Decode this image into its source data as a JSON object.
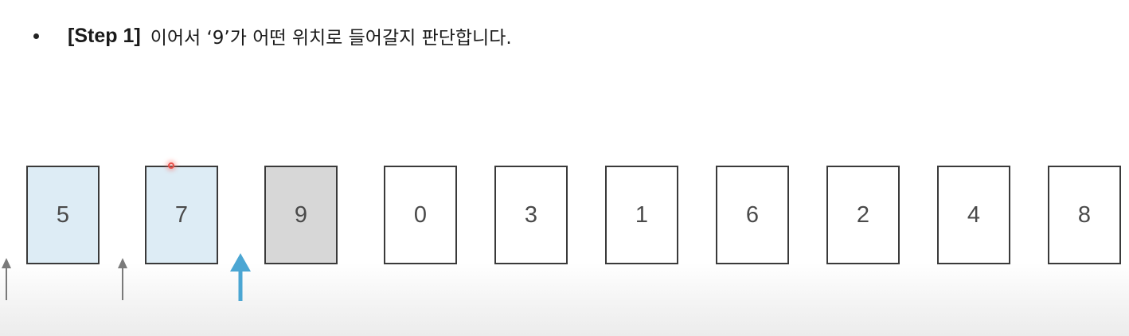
{
  "slide": {
    "step_label": "[Step 1]",
    "instruction": "이어서 ‘9’가 어떤 위치로 들어갈지 판단합니다."
  },
  "cards": [
    {
      "value": "5",
      "state": "sorted"
    },
    {
      "value": "7",
      "state": "sorted"
    },
    {
      "value": "9",
      "state": "current"
    },
    {
      "value": "0",
      "state": "unsorted"
    },
    {
      "value": "3",
      "state": "unsorted"
    },
    {
      "value": "1",
      "state": "unsorted"
    },
    {
      "value": "6",
      "state": "unsorted"
    },
    {
      "value": "2",
      "state": "unsorted"
    },
    {
      "value": "4",
      "state": "unsorted"
    },
    {
      "value": "8",
      "state": "unsorted"
    }
  ],
  "colors": {
    "sorted_fill": "#ddecf5",
    "current_fill": "#d7d7d7",
    "unsorted_fill": "#ffffff",
    "candidate_arrow": "#7a7a7a",
    "selected_arrow": "#4ba6d3"
  },
  "arrows": [
    {
      "name": "insert-position-arrow-0",
      "kind": "candidate"
    },
    {
      "name": "insert-position-arrow-1",
      "kind": "candidate"
    },
    {
      "name": "insert-position-arrow-2",
      "kind": "selected"
    }
  ]
}
